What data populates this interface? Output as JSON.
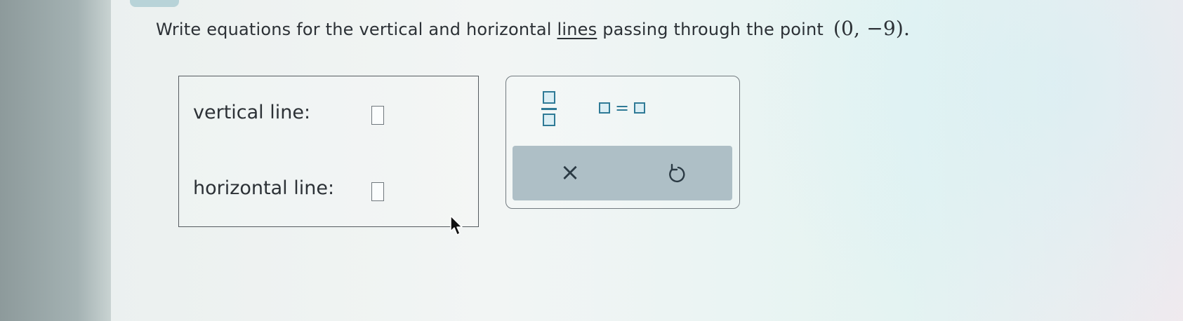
{
  "question": {
    "prefix": "Write equations for the vertical and horizontal",
    "link": "lines",
    "suffix": "passing through the point",
    "point": "(0, −9)."
  },
  "answers": {
    "vertical_label": "vertical line:",
    "horizontal_label": "horizontal line:",
    "vertical_value": "",
    "horizontal_value": ""
  },
  "keypad": {
    "equals_sign": "=",
    "clear_symbol": "×"
  },
  "icons": {
    "fraction": "fraction-template-icon",
    "equation": "equation-template-icon",
    "clear": "clear-icon",
    "undo": "undo-icon",
    "cursor": "mouse-cursor-icon"
  },
  "colors": {
    "accent": "#2f7a96",
    "action_bar": "#aebfc6",
    "text": "#2c3136"
  }
}
